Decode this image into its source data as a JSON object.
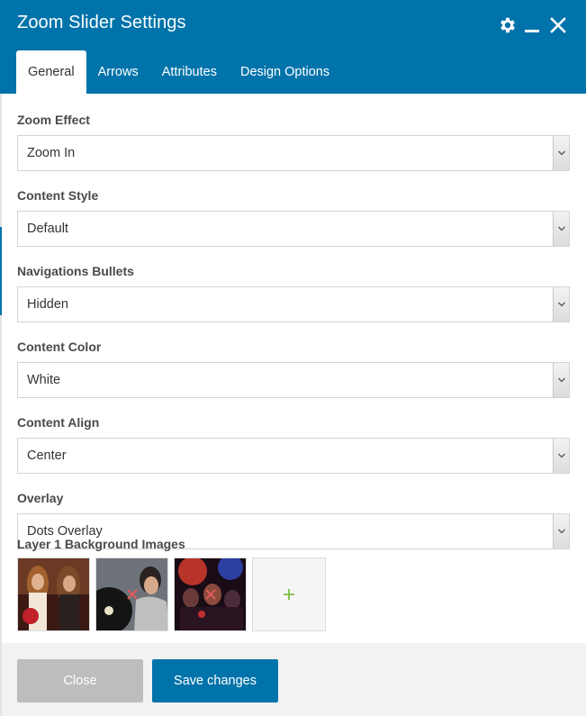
{
  "window": {
    "title": "Zoom Slider Settings",
    "icons": [
      "gear-icon",
      "minimize-icon",
      "close-icon"
    ]
  },
  "tabs": [
    {
      "label": "General",
      "active": true
    },
    {
      "label": "Arrows",
      "active": false
    },
    {
      "label": "Attributes",
      "active": false
    },
    {
      "label": "Design Options",
      "active": false
    }
  ],
  "fields": [
    {
      "label": "Zoom Effect",
      "value": "Zoom In"
    },
    {
      "label": "Content Style",
      "value": "Default"
    },
    {
      "label": "Navigations Bullets",
      "value": "Hidden"
    },
    {
      "label": "Content Color",
      "value": "White"
    },
    {
      "label": "Content Align",
      "value": "Center"
    },
    {
      "label": "Overlay",
      "value": "Dots Overlay"
    }
  ],
  "images": {
    "label": "Layer 1 Background Images",
    "add_icon": "plus-icon",
    "remove_icon": "remove-x-icon"
  },
  "footer": {
    "close_label": "Close",
    "save_label": "Save changes"
  },
  "colors": {
    "accent": "#0073aa",
    "close_button": "#bdbdbd",
    "add_plus": "#7bc043",
    "remove_x": "#e05a5a"
  }
}
